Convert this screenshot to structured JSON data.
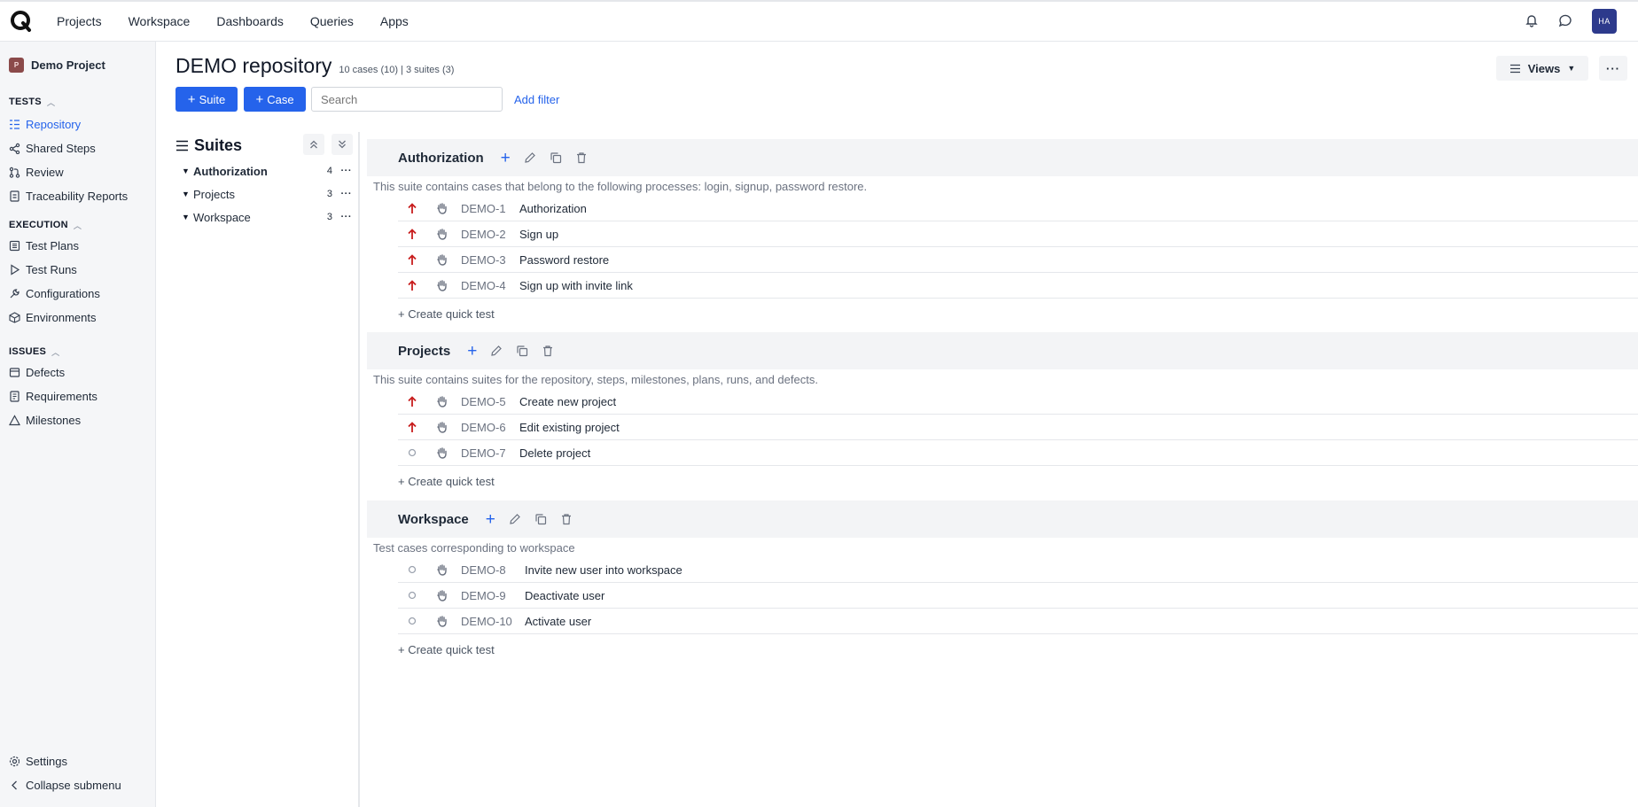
{
  "topbar": {
    "nav": [
      "Projects",
      "Workspace",
      "Dashboards",
      "Queries",
      "Apps"
    ],
    "avatar_initials": "HA"
  },
  "sidebar": {
    "project_name": "Demo Project",
    "project_icon_text": "P",
    "sections": [
      {
        "label": "TESTS",
        "items": [
          {
            "label": "Repository",
            "icon": "repository-icon",
            "active": true
          },
          {
            "label": "Shared Steps",
            "icon": "shared-steps-icon"
          },
          {
            "label": "Review",
            "icon": "review-icon"
          },
          {
            "label": "Traceability Reports",
            "icon": "report-icon"
          }
        ]
      },
      {
        "label": "EXECUTION",
        "items": [
          {
            "label": "Test Plans",
            "icon": "test-plans-icon"
          },
          {
            "label": "Test Runs",
            "icon": "play-icon"
          },
          {
            "label": "Configurations",
            "icon": "wrench-icon"
          },
          {
            "label": "Environments",
            "icon": "cube-icon"
          }
        ]
      },
      {
        "label": "ISSUES",
        "items": [
          {
            "label": "Defects",
            "icon": "defects-icon"
          },
          {
            "label": "Requirements",
            "icon": "requirements-icon"
          },
          {
            "label": "Milestones",
            "icon": "milestone-icon"
          }
        ]
      }
    ],
    "settings_label": "Settings",
    "collapse_label": "Collapse submenu"
  },
  "header": {
    "title": "DEMO repository",
    "subtitle": "10 cases (10) | 3 suites (3)",
    "suite_button": "Suite",
    "case_button": "Case",
    "search_placeholder": "Search",
    "add_filter": "Add filter",
    "views_label": "Views"
  },
  "suites_panel": {
    "title": "Suites",
    "items": [
      {
        "label": "Authorization",
        "count": "4",
        "bold": true
      },
      {
        "label": "Projects",
        "count": "3"
      },
      {
        "label": "Workspace",
        "count": "3"
      }
    ]
  },
  "suites": [
    {
      "name": "Authorization",
      "description": "This suite contains cases that belong to the following processes: login, signup, password restore.",
      "cases": [
        {
          "id": "DEMO-1",
          "name": "Authorization",
          "priority": "high"
        },
        {
          "id": "DEMO-2",
          "name": "Sign up",
          "priority": "high"
        },
        {
          "id": "DEMO-3",
          "name": "Password restore",
          "priority": "high"
        },
        {
          "id": "DEMO-4",
          "name": "Sign up with invite link",
          "priority": "high"
        }
      ],
      "quick_label": "+ Create quick test"
    },
    {
      "name": "Projects",
      "description": "This suite contains suites for the repository, steps, milestones, plans, runs, and defects.",
      "cases": [
        {
          "id": "DEMO-5",
          "name": "Create new project",
          "priority": "high"
        },
        {
          "id": "DEMO-6",
          "name": "Edit existing project",
          "priority": "high"
        },
        {
          "id": "DEMO-7",
          "name": "Delete project",
          "priority": "none"
        }
      ],
      "quick_label": "+ Create quick test"
    },
    {
      "name": "Workspace",
      "description": "Test cases corresponding to workspace",
      "cases": [
        {
          "id": "DEMO-8",
          "name": "Invite new user into workspace",
          "priority": "none"
        },
        {
          "id": "DEMO-9",
          "name": "Deactivate user",
          "priority": "none"
        },
        {
          "id": "DEMO-10",
          "name": "Activate user",
          "priority": "none"
        }
      ],
      "quick_label": "+ Create quick test"
    }
  ],
  "colors": {
    "accent": "#2563eb",
    "priority_high": "#c81e1e",
    "sidebar_bg": "#f5f6f8",
    "avatar_bg": "#2d3a8c"
  }
}
